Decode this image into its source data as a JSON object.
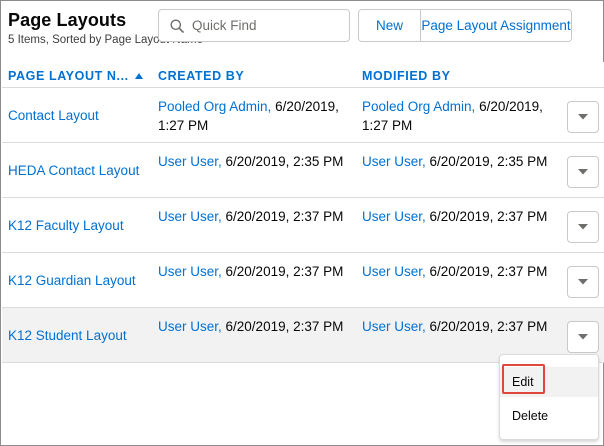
{
  "header": {
    "title": "Page Layouts",
    "subtitle": "5 Items, Sorted by Page Layout Name"
  },
  "search": {
    "placeholder": "Quick Find",
    "value": "",
    "icon": "search-icon"
  },
  "toolbar": {
    "new_label": "New",
    "assignment_label": "Page Layout Assignment"
  },
  "table": {
    "columns": [
      "PAGE LAYOUT N...",
      "CREATED BY",
      "MODIFIED BY"
    ],
    "sort_column": "PAGE LAYOUT N...",
    "sort_direction": "ascending",
    "rows": [
      {
        "name": "Contact Layout",
        "created_user": "Pooled Org Admin,",
        "created_date": "6/20/2019, 1:27 PM",
        "modified_user": "Pooled Org Admin,",
        "modified_date": "6/20/2019, 1:27 PM"
      },
      {
        "name": "HEDA Contact Layout",
        "created_user": "User User,",
        "created_date": "6/20/2019, 2:35 PM",
        "modified_user": "User User,",
        "modified_date": "6/20/2019, 2:35 PM"
      },
      {
        "name": "K12 Faculty Layout",
        "created_user": "User User,",
        "created_date": "6/20/2019, 2:37 PM",
        "modified_user": "User User,",
        "modified_date": "6/20/2019, 2:37 PM"
      },
      {
        "name": "K12 Guardian Layout",
        "created_user": "User User,",
        "created_date": "6/20/2019, 2:37 PM",
        "modified_user": "User User,",
        "modified_date": "6/20/2019, 2:37 PM"
      },
      {
        "name": "K12 Student Layout",
        "created_user": "User User,",
        "created_date": "6/20/2019, 2:37 PM",
        "modified_user": "User User,",
        "modified_date": "6/20/2019, 2:37 PM"
      }
    ]
  },
  "row_menu": {
    "items": [
      "Edit",
      "Delete"
    ],
    "open_row": "K12 Student Layout",
    "highlighted_item": "Edit"
  },
  "colors": {
    "link": "#0070d2",
    "highlight_border": "#e0463d",
    "hover_row": "#f3f2f2"
  }
}
